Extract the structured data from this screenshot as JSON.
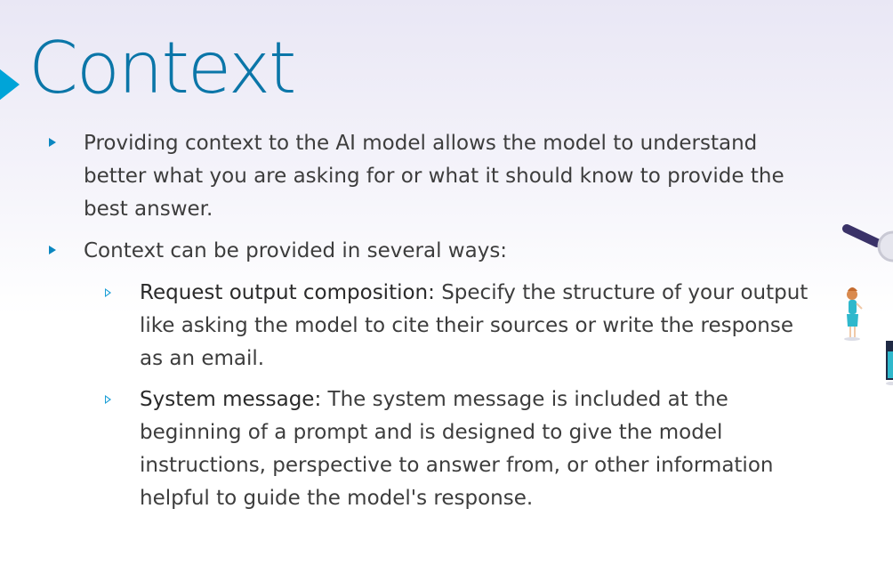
{
  "slide": {
    "title": "Context",
    "bullets": [
      {
        "text": "Providing context to the AI model allows the model to understand better what you are asking for or what it should know to provide the best answer."
      },
      {
        "text": "Context can be provided in several ways:",
        "sub_bullets": [
          {
            "term": "Request output composition:",
            "text": " Specify the structure of your output like asking the model to cite their sources or write the response as an email."
          },
          {
            "term": "System message:",
            "text": " The system message is included at the beginning of a prompt and is designed to give the model instructions, perspective to answer from, or other information helpful to guide the model's response."
          }
        ]
      }
    ]
  },
  "colors": {
    "accent": "#00a4d8",
    "title": "#0b76a8",
    "text": "#3d3d3d"
  },
  "icons": {
    "title_marker": "triangle-right-icon",
    "bullet": "triangle-bullet-icon",
    "sub_bullet": "outlined-triangle-bullet-icon",
    "illustration": "people-illustration"
  }
}
